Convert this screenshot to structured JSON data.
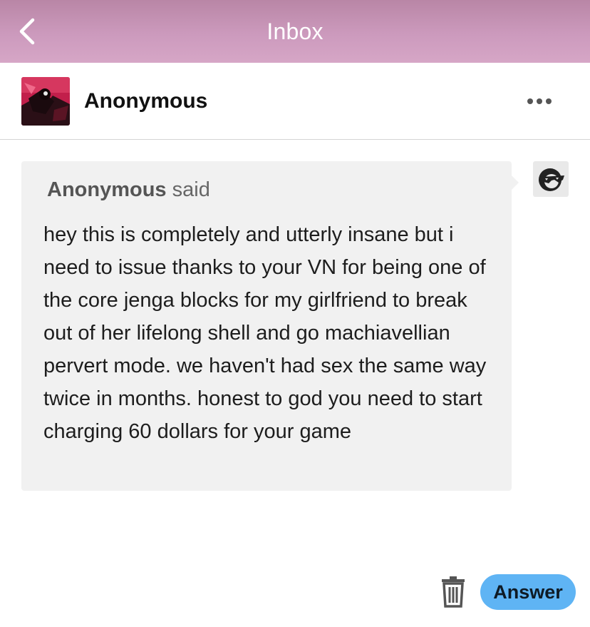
{
  "topbar": {
    "title": "Inbox",
    "back_icon": "chevron-left-icon"
  },
  "message_header": {
    "sender_name": "Anonymous",
    "more_icon": "more-horizontal-icon"
  },
  "message": {
    "asker_name": "Anonymous",
    "said_word": "said",
    "question_text": "hey this is completely and utterly insane but i need to issue thanks to your VN for being one of the core jenga blocks for my girlfriend to break out of her lifelong shell and go machiavellian pervert mode. we haven't had sex the same way twice in months. honest to god you need to start charging 60 dollars for your game",
    "asker_avatar_icon": "sunglasses-face-icon"
  },
  "actions": {
    "trash_icon": "trash-icon",
    "answer_label": "Answer"
  },
  "colors": {
    "topbar_gradient_start": "#b986a6",
    "topbar_gradient_end": "#d6a6c6",
    "bubble_bg": "#f1f1f1",
    "answer_button": "#5fb4f4"
  }
}
